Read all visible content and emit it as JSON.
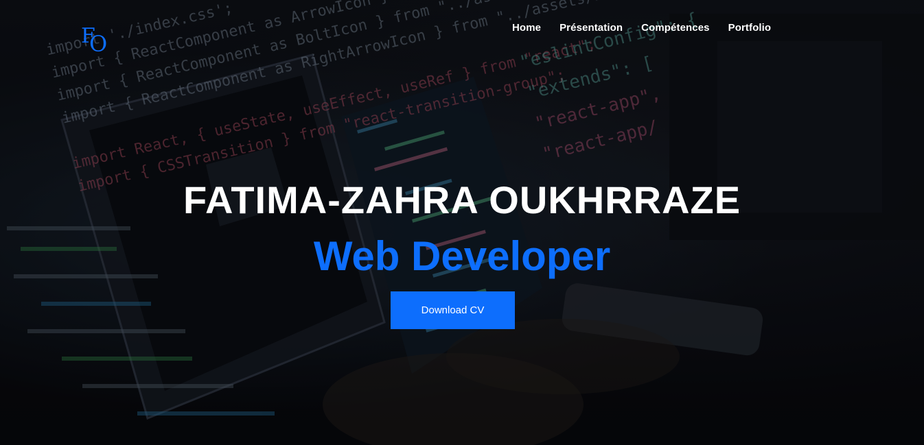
{
  "header": {
    "logo": {
      "letter_1": "F",
      "letter_2": "O"
    },
    "nav": [
      {
        "label": "Home"
      },
      {
        "label": "Présentation"
      },
      {
        "label": "Compétences"
      },
      {
        "label": "Portfolio"
      }
    ]
  },
  "hero": {
    "name": "FATIMA-ZAHRA OUKHRRAZE",
    "role": "Web Developer",
    "cta_label": "Download CV",
    "background_code_left": [
      "import './index.css';",
      "import { ReactComponent as ArrowIcon } from \"../assets/icons/arrow.svg\";",
      "import { ReactComponent as BoltIcon } from \"../assets/icons/bolt.svg\";",
      "import { ReactComponent as RightArrowIcon } from \"../assets/icons/right-arrow.svg\";",
      "",
      "import React, { useState, useEffect, useRef } from \"react\";",
      "import { CSSTransition } from \"react-transition-group\";"
    ],
    "background_code_right": [
      "\"eslintConfig\": {",
      "  \"extends\": [",
      "    \"react-app\",",
      "    \"react-app/"
    ]
  },
  "colors": {
    "accent": "#0d6efd",
    "text": "#ffffff",
    "background": "#0a0c12"
  }
}
